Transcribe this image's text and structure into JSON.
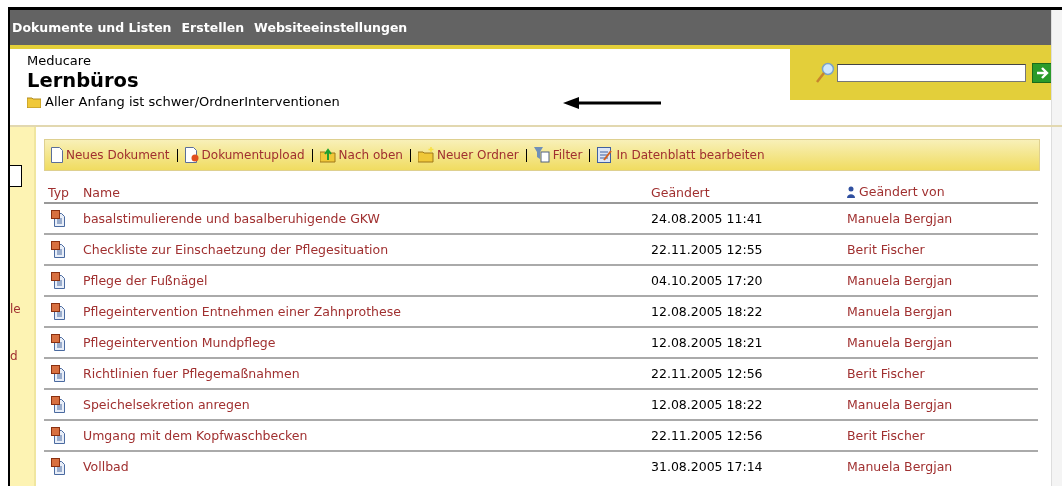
{
  "top_nav": {
    "items": [
      "Dokumente und Listen",
      "Erstellen",
      "Websiteeinstellungen"
    ]
  },
  "header": {
    "site": "Meducare",
    "title": "Lernbüros",
    "breadcrumb": "Aller Anfang ist schwer/OrdnerInterventionen"
  },
  "sidebar": {
    "items": [
      "le",
      "d"
    ]
  },
  "toolbar": [
    {
      "kind": "new",
      "label": "Neues Dokument"
    },
    {
      "kind": "upload",
      "label": "Dokumentupload"
    },
    {
      "kind": "up",
      "label": "Nach oben"
    },
    {
      "kind": "folder",
      "label": "Neuer Ordner"
    },
    {
      "kind": "filter",
      "label": "Filter"
    },
    {
      "kind": "sheet",
      "label": "In Datenblatt bearbeiten"
    }
  ],
  "table": {
    "columns": [
      "Typ",
      "Name",
      "Geändert",
      "Geändert von"
    ],
    "rows": [
      {
        "name": "basalstimulierende und basalberuhigende GKW",
        "modified": "24.08.2005 11:41",
        "by": "Manuela Bergjan"
      },
      {
        "name": "Checkliste zur Einschaetzung der Pflegesituation",
        "modified": "22.11.2005 12:55",
        "by": "Berit Fischer"
      },
      {
        "name": "Pflege der Fußnägel",
        "modified": "04.10.2005 17:20",
        "by": "Manuela Bergjan"
      },
      {
        "name": "Pflegeintervention Entnehmen einer Zahnprothese",
        "modified": "12.08.2005 18:22",
        "by": "Manuela Bergjan"
      },
      {
        "name": "Pflegeintervention Mundpflege",
        "modified": "12.08.2005 18:21",
        "by": "Manuela Bergjan"
      },
      {
        "name": "Richtlinien fuer Pflegemaßnahmen",
        "modified": "22.11.2005 12:56",
        "by": "Berit Fischer"
      },
      {
        "name": "Speichelsekretion anregen",
        "modified": "12.08.2005 18:22",
        "by": "Manuela Bergjan"
      },
      {
        "name": "Umgang mit dem Kopfwaschbecken",
        "modified": "22.11.2005 12:56",
        "by": "Berit Fischer"
      },
      {
        "name": "Vollbad",
        "modified": "31.08.2005 17:14",
        "by": "Manuela Bergjan"
      }
    ]
  }
}
